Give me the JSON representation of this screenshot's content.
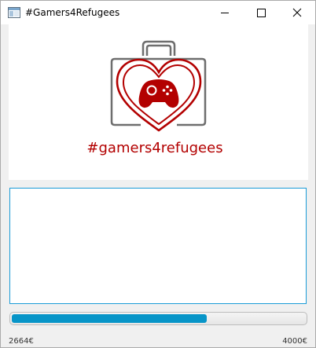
{
  "window": {
    "title": "#Gamers4Refugees",
    "controls": {
      "minimize_icon": "minimize-icon",
      "maximize_icon": "maximize-icon",
      "close_icon": "close-icon"
    }
  },
  "logo": {
    "caption": "#gamers4refugees",
    "icon": "heart-gamepad-suitcase-logo",
    "colors": {
      "red": "#b30000",
      "gray": "#6e6e6e"
    }
  },
  "message_box": {
    "value": ""
  },
  "progress": {
    "raised_label": "2664€",
    "goal_label": "4000€",
    "fraction": 0.666,
    "color": "#0795c8"
  }
}
